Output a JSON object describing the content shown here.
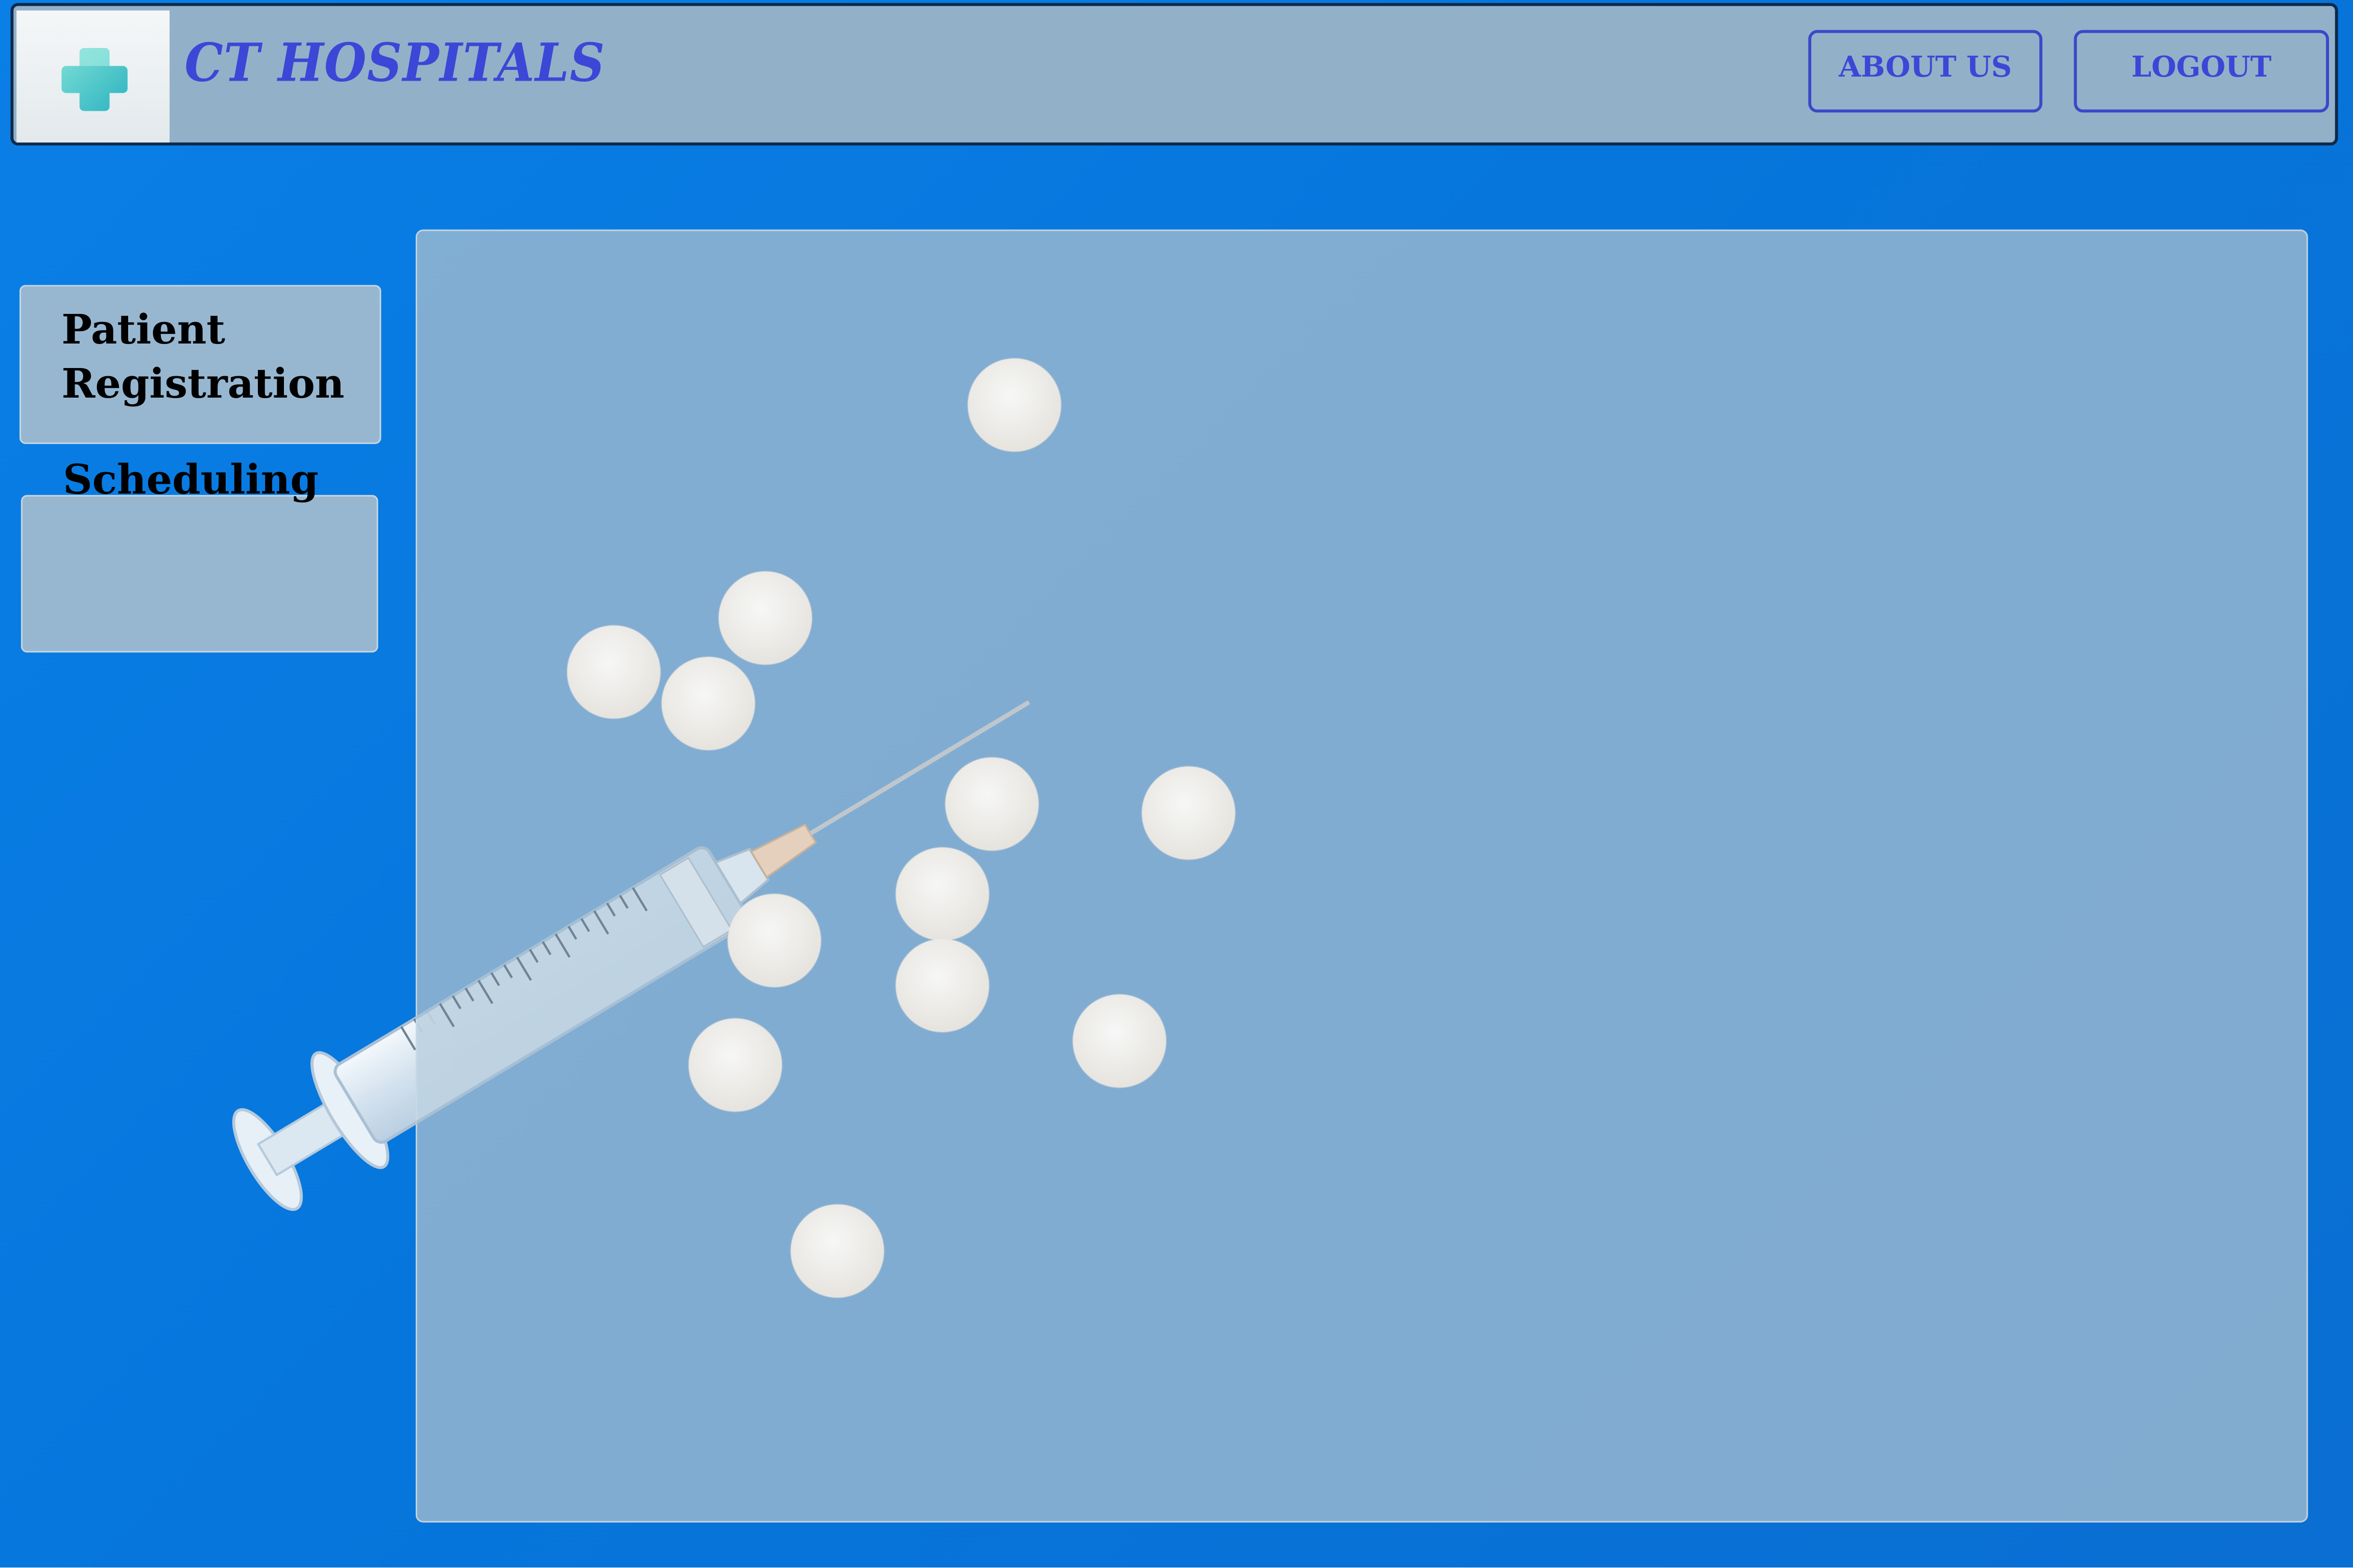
{
  "header": {
    "brand_title": "CT HOSPITALS",
    "logo_icon": "medical-cross-icon",
    "about_label": "ABOUT US",
    "logout_label": "LOGOUT"
  },
  "sidebar": {
    "items": [
      {
        "label": "Patient Registration"
      },
      {
        "label": "Scheduling"
      }
    ]
  },
  "main": {
    "background_image": "pills-and-syringe-photo"
  },
  "colors": {
    "background": "#0676dc",
    "header_bg": "#93b0c9",
    "brand_text": "#3b47d6",
    "nav_text": "#000000",
    "logo_cross": "#3cc3c7"
  }
}
